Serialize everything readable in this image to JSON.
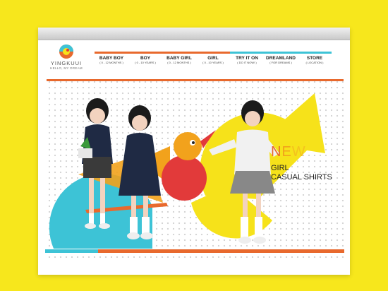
{
  "brand": {
    "name": "YINGKUUI",
    "tagline": "HELLO, MY DREAM"
  },
  "nav": [
    {
      "label": "BABY BOY",
      "sub": "( 0 - 12 MONTHS )",
      "accent": "orange"
    },
    {
      "label": "BOY",
      "sub": "( 0 - 10 YEARS )",
      "accent": "orange"
    },
    {
      "label": "BABY GIRL",
      "sub": "( 0 - 12 MONTHS )",
      "accent": "orange"
    },
    {
      "label": "GIRL",
      "sub": "( 0 - 10 YEARS )",
      "accent": "orange"
    },
    {
      "label": "TRY IT ON",
      "sub": "( DO IT NOW! )",
      "accent": "blue"
    },
    {
      "label": "DREAMLAND",
      "sub": "( FOR DREAMS )",
      "accent": "blue"
    },
    {
      "label": "STORE",
      "sub": "( LOCATION )",
      "accent": "blue"
    }
  ],
  "promo": {
    "new_n": "N",
    "new_e": "E",
    "new_w": "W",
    "line1": "GIRL",
    "line2": "CASUAL SHIRTS"
  },
  "colors": {
    "background": "#f7e71c",
    "orange": "#e8692d",
    "blue": "#3dc3d6",
    "yellow": "#f6e21a",
    "red": "#e23a3a"
  },
  "icons": [
    "logo-icon",
    "bird-toy-icon"
  ]
}
